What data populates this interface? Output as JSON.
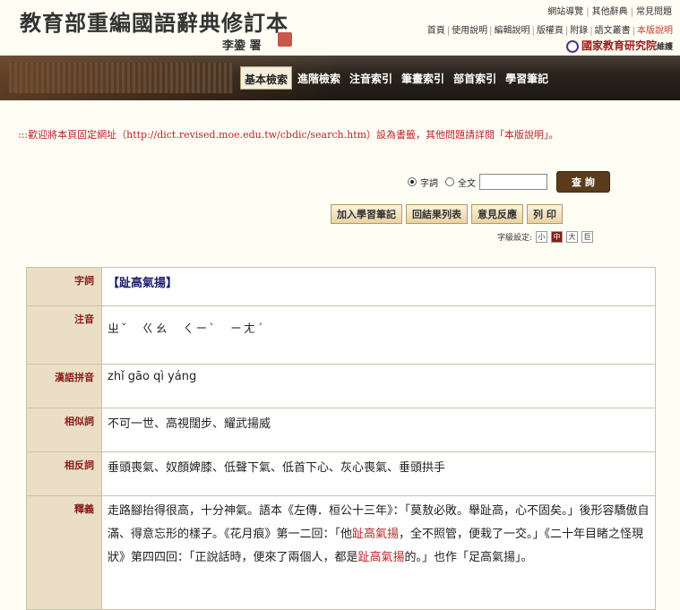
{
  "header": {
    "title": "教育部重編國語辭典修訂本",
    "signature": "李鍌 署",
    "top_links": [
      "網站導覽",
      "其他辭典",
      "常見問題"
    ],
    "links": [
      "首頁",
      "使用說明",
      "編輯說明",
      "版權頁",
      "附錄",
      "語文叢書",
      "本版說明"
    ],
    "institute": "國家教育研究院",
    "institute_suffix": "維護"
  },
  "nav": {
    "items": [
      "基本檢索",
      "進階檢索",
      "注音索引",
      "筆畫索引",
      "部首索引",
      "學習筆記"
    ],
    "active": "基本檢索"
  },
  "notice": ":::歡迎將本頁固定網址（http://dict.revised.moe.edu.tw/cbdic/search.htm）設為書籤，其他問題請詳閱「本版說明」。",
  "search": {
    "option_word": "字詞",
    "option_full": "全文",
    "selected": "字詞",
    "query": "",
    "button": "查 詢"
  },
  "actions": [
    "加入學習筆記",
    "回結果列表",
    "意見反應",
    "列 印"
  ],
  "font_size": {
    "label": "字級設定:",
    "options": [
      "小",
      "中",
      "大",
      "巨"
    ],
    "selected": "中"
  },
  "entry": {
    "rows": [
      {
        "label": "字詞",
        "value": "【趾高氣揚】"
      },
      {
        "label": "注音",
        "value": "ㄓˇ　ㄍㄠ　ㄑㄧˋ　ㄧㄤˊ"
      },
      {
        "label": "漢語拼音",
        "value": "zhǐ gāo qì yáng"
      },
      {
        "label": "相似詞",
        "value": "不可一世、高視闊步、耀武揚威"
      },
      {
        "label": "相反詞",
        "value": "垂頭喪氣、奴顏婢膝、低聲下氣、低首下心、灰心喪氣、垂頭拱手"
      },
      {
        "label": "釋義",
        "value": ""
      }
    ],
    "definition": {
      "p1": "走路腳抬得很高，十分神氣。語本《左傳．桓公十三年》：「莫敖必敗。舉趾高，心不固矣。」後形容驕傲自滿、得意忘形的樣子。《花月痕》第一二回：「他",
      "hl1": "趾高氣揚",
      "p2": "，全不照管，便栽了一交。」《二十年目睹之怪現狀》第四四回：「正說話時，便來了兩個人，都是",
      "hl2": "趾高氣揚",
      "p3": "的。」也作「足高氣揚」。"
    }
  }
}
